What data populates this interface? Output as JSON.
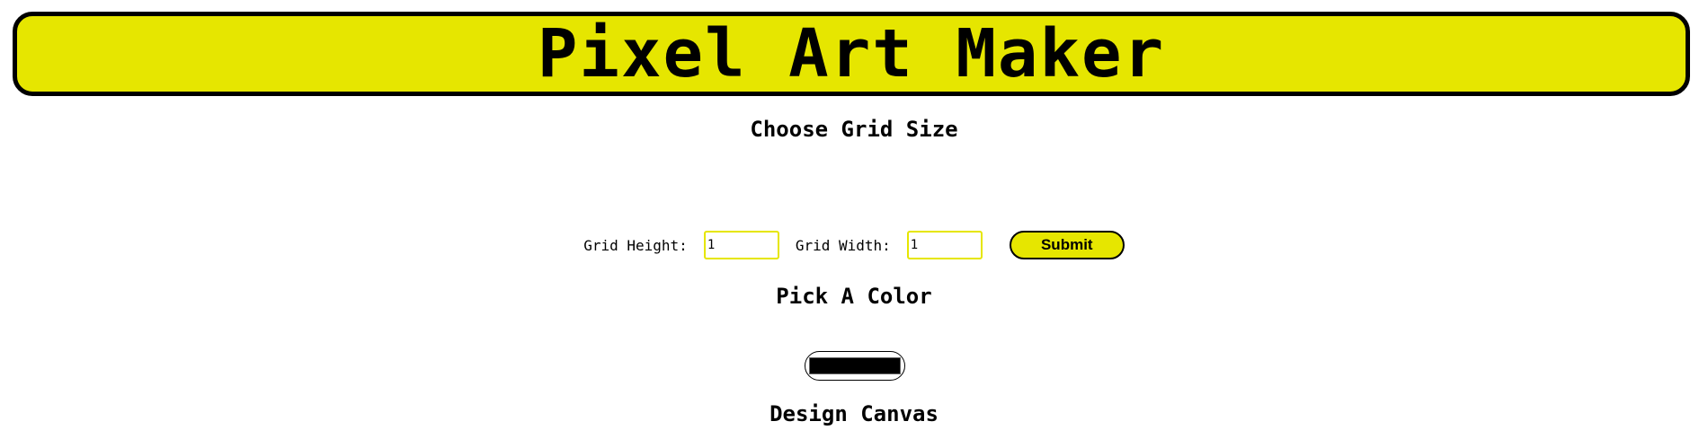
{
  "header": {
    "title": "Pixel Art Maker"
  },
  "grid_size": {
    "heading": "Choose Grid Size",
    "height_label": "Grid Height:",
    "height_value": "1",
    "width_label": "Grid Width:",
    "width_value": "1",
    "submit_label": "Submit"
  },
  "color": {
    "heading": "Pick A Color",
    "value": "#000000"
  },
  "canvas": {
    "heading": "Design Canvas"
  },
  "theme": {
    "accent": "#e6e600",
    "border": "#000000"
  }
}
